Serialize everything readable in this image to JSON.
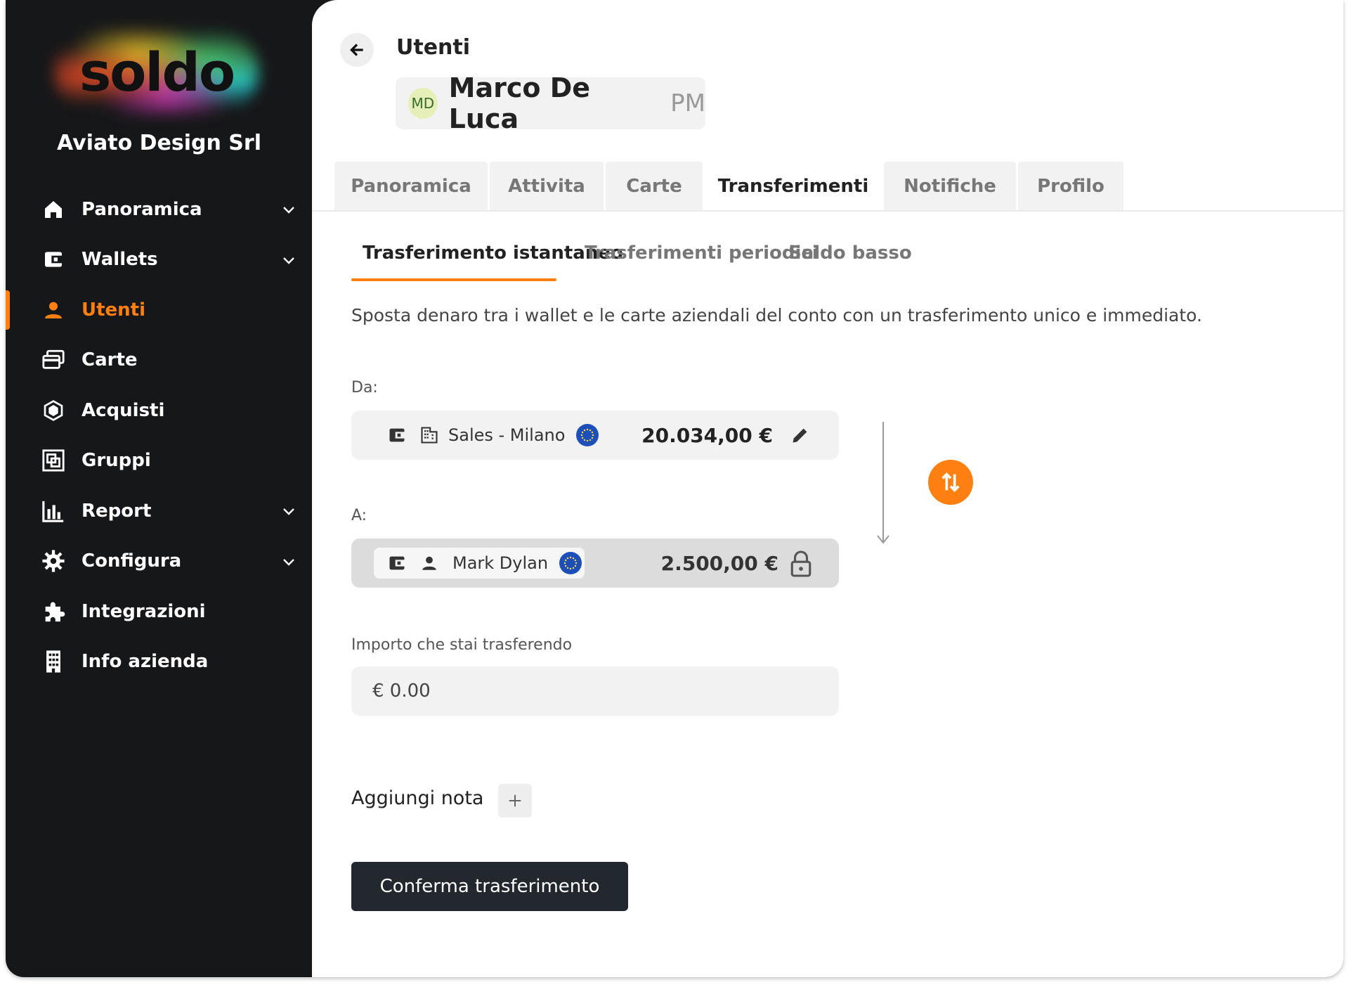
{
  "brand": {
    "logo": "soldo",
    "company": "Aviato Design Srl",
    "accent": "#ff7f11"
  },
  "sidebar": {
    "items": [
      {
        "label": "Panoramica",
        "icon": "home-icon",
        "has_chevron": true
      },
      {
        "label": "Wallets",
        "icon": "wallet-icon",
        "has_chevron": true
      },
      {
        "label": "Utenti",
        "icon": "user-icon",
        "active": true
      },
      {
        "label": "Carte",
        "icon": "cards-icon"
      },
      {
        "label": "Acquisti",
        "icon": "hexagon-icon"
      },
      {
        "label": "Gruppi",
        "icon": "groups-icon"
      },
      {
        "label": "Report",
        "icon": "bar-chart-icon",
        "has_chevron": true
      },
      {
        "label": "Configura",
        "icon": "gear-icon",
        "has_chevron": true
      },
      {
        "label": "Integrazioni",
        "icon": "puzzle-icon"
      },
      {
        "label": "Info azienda",
        "icon": "building-icon"
      }
    ]
  },
  "header": {
    "breadcrumb": "Utenti",
    "user": {
      "initials": "MD",
      "name": "Marco De Luca",
      "role": "PM"
    }
  },
  "tabs": [
    "Panoramica",
    "Attivita",
    "Carte",
    "Transferimenti",
    "Notifiche",
    "Profilo"
  ],
  "active_tab": "Transferimenti",
  "subtabs": [
    "Trasferimento istantaneo",
    "Trasferimenti periodici",
    "Saldo basso"
  ],
  "active_subtab": "Trasferimento istantaneo",
  "description": "Sposta denaro tra i wallet e le carte aziendali del conto con un trasferimento unico e immediato.",
  "transfer": {
    "from_label": "Da:",
    "from": {
      "name": "Sales - Milano",
      "amount": "20.034,00 €",
      "icons": [
        "wallet-icon",
        "building-icon",
        "eu-flag-icon",
        "pencil-icon"
      ]
    },
    "to_label": "A:",
    "to": {
      "name": "Mark Dylan",
      "amount": "2.500,00 €",
      "icons": [
        "wallet-icon",
        "user-icon",
        "eu-flag-icon",
        "lock-icon"
      ]
    },
    "amount_label": "Importo che stai trasferendo",
    "amount_value": "€ 0.00",
    "note_label": "Aggiungi nota",
    "confirm_label": "Conferma trasferimento"
  }
}
